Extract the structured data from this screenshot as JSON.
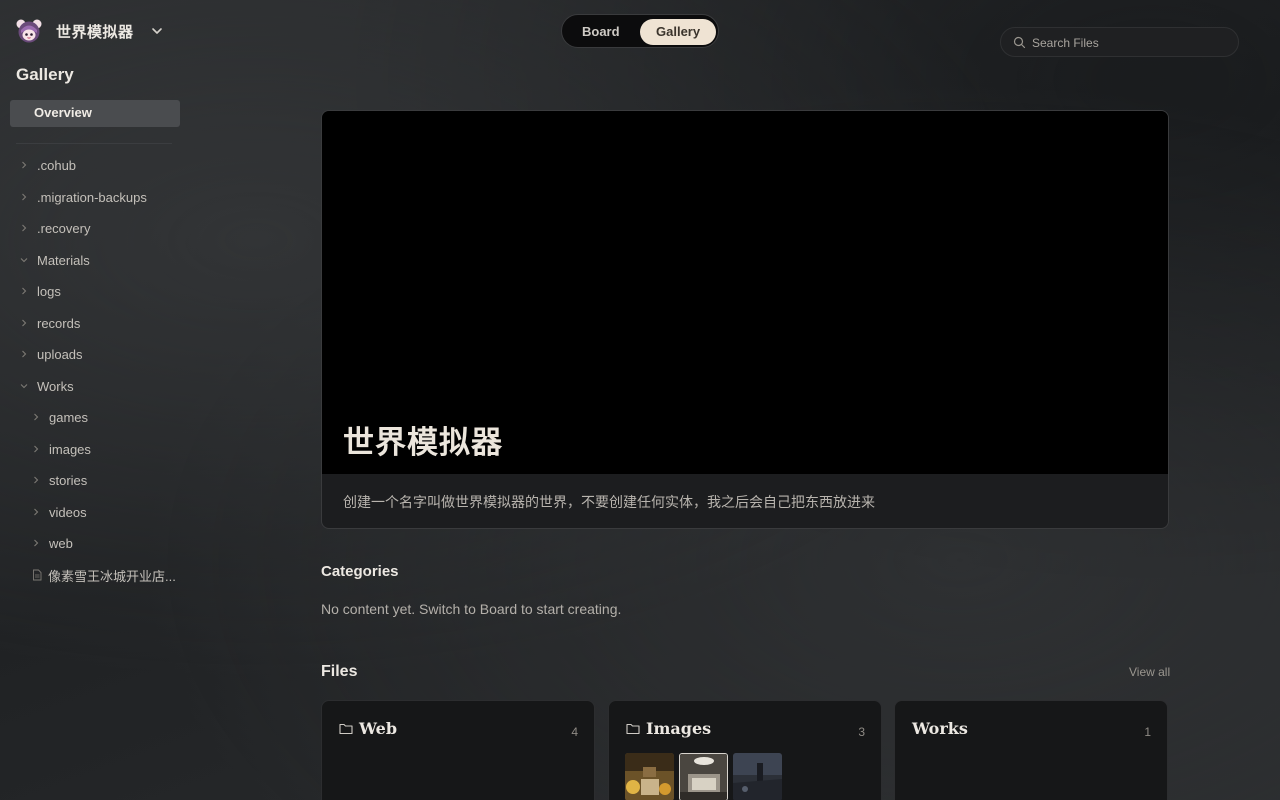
{
  "app": {
    "name": "世界模拟器"
  },
  "sidebar": {
    "title": "Gallery",
    "overview_label": "Overview",
    "items": [
      {
        "label": ".cohub",
        "expanded": false
      },
      {
        "label": ".migration-backups",
        "expanded": false
      },
      {
        "label": ".recovery",
        "expanded": false
      },
      {
        "label": "Materials",
        "expanded": true
      },
      {
        "label": "logs",
        "expanded": false
      },
      {
        "label": "records",
        "expanded": false
      },
      {
        "label": "uploads",
        "expanded": false
      },
      {
        "label": "Works",
        "expanded": true
      },
      {
        "label": "games",
        "expanded": false
      },
      {
        "label": "images",
        "expanded": false
      },
      {
        "label": "stories",
        "expanded": false
      },
      {
        "label": "videos",
        "expanded": false
      },
      {
        "label": "web",
        "expanded": false
      },
      {
        "label": "像素雪王冰城开业店..."
      }
    ]
  },
  "view_toggle": {
    "board_label": "Board",
    "gallery_label": "Gallery",
    "active": "Gallery"
  },
  "search": {
    "placeholder": "Search Files",
    "value": ""
  },
  "hero": {
    "title": "世界模拟器",
    "description": "创建一个名字叫做世界模拟器的世界，不要创建任何实体，我之后会自己把东西放进来"
  },
  "categories": {
    "title": "Categories",
    "empty_text": "No content yet. Switch to Board to start creating."
  },
  "files": {
    "title": "Files",
    "view_all_label": "View all",
    "cards": [
      {
        "title": "Web",
        "count": "4"
      },
      {
        "title": "Images",
        "count": "3"
      },
      {
        "title": "Works",
        "count": "1"
      }
    ]
  },
  "colors": {
    "accent": "#efe3d3",
    "overview_bg": "#4a4c4f",
    "hero_bg": "#000000"
  }
}
